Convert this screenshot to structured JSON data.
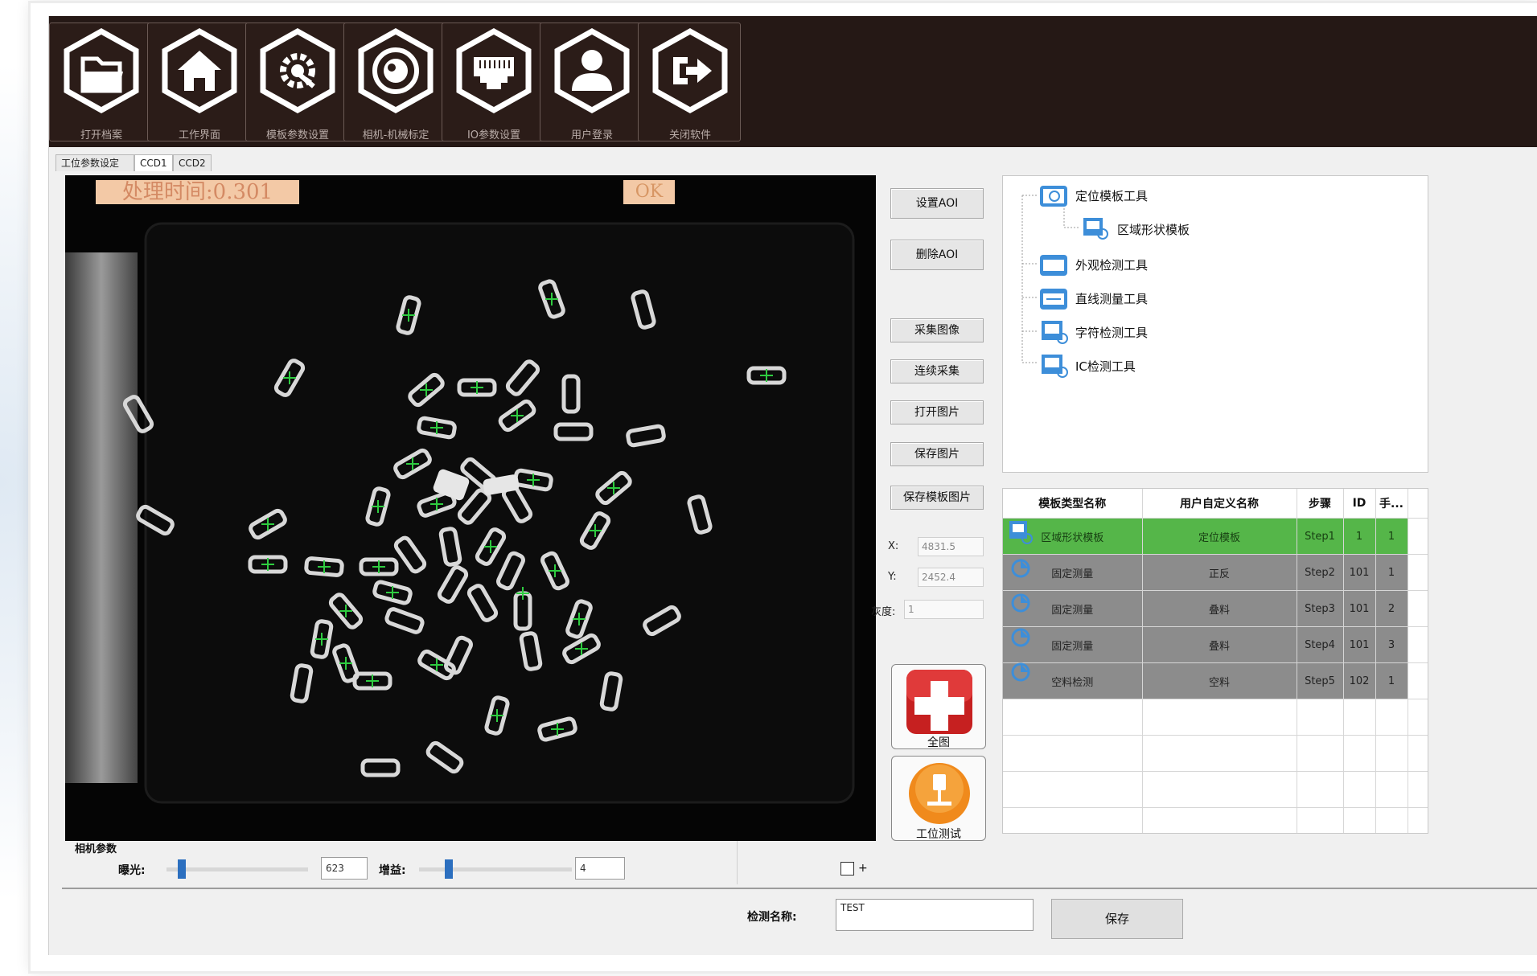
{
  "toolbar": {
    "buttons": [
      {
        "label": "打开档案",
        "icon": "folder-icon"
      },
      {
        "label": "工作界面",
        "icon": "home-icon"
      },
      {
        "label": "模板参数设置",
        "icon": "gear-wrench-icon"
      },
      {
        "label": "相机-机械标定",
        "icon": "camera-lens-icon"
      },
      {
        "label": "IO参数设置",
        "icon": "io-port-icon"
      },
      {
        "label": "用户登录",
        "icon": "user-icon"
      },
      {
        "label": "关闭软件",
        "icon": "exit-icon"
      }
    ]
  },
  "tabs": [
    "工位参数设定",
    "CCD1",
    "CCD2"
  ],
  "active_tab": "CCD1",
  "viewer": {
    "process_time": "处理时间:0.301",
    "status": "OK"
  },
  "side_buttons": {
    "set_aoi": "设置AOI",
    "delete_aoi": "删除AOI",
    "capture": "采集图像",
    "continuous": "连续采集",
    "open_image": "打开图片",
    "save_image": "保存图片",
    "save_template_image": "保存模板图片"
  },
  "coords": {
    "x_label": "X:",
    "x_value": "4831.5",
    "y_label": "Y:",
    "y_value": "2452.4",
    "gray_label": "灰度:",
    "gray_value": "1"
  },
  "big_buttons": {
    "add": "全图",
    "station_test": "工位测试"
  },
  "tree": {
    "items": [
      {
        "label": "定位模板工具",
        "level": 0
      },
      {
        "label": "区域形状模板",
        "level": 1
      },
      {
        "label": "外观检测工具",
        "level": 0
      },
      {
        "label": "直线测量工具",
        "level": 0
      },
      {
        "label": "字符检测工具",
        "level": 0
      },
      {
        "label": "IC检测工具",
        "level": 0
      }
    ]
  },
  "grid": {
    "headers": [
      "模板类型名称",
      "用户自定义名称",
      "步骤",
      "ID",
      "手..."
    ],
    "rows": [
      {
        "type": "区域形状模板",
        "name": "定位模板",
        "step": "Step1",
        "id": "1",
        "hand": "1",
        "style": "sel"
      },
      {
        "type": "固定测量",
        "name": "正反",
        "step": "Step2",
        "id": "101",
        "hand": "1",
        "style": "gray"
      },
      {
        "type": "固定测量",
        "name": "叠料",
        "step": "Step3",
        "id": "101",
        "hand": "2",
        "style": "gray"
      },
      {
        "type": "固定测量",
        "name": "叠料",
        "step": "Step4",
        "id": "101",
        "hand": "3",
        "style": "gray"
      },
      {
        "type": "空料检测",
        "name": "空料",
        "step": "Step5",
        "id": "102",
        "hand": "1",
        "style": "gray"
      }
    ]
  },
  "camera": {
    "title": "相机参数",
    "exposure_label": "曝光:",
    "exposure_value": "623",
    "gain_label": "增益:",
    "gain_value": "4",
    "checkbox_label": "+"
  },
  "bottom": {
    "name_label": "检测名称:",
    "name_value": "TEST",
    "save_label": "保存"
  }
}
